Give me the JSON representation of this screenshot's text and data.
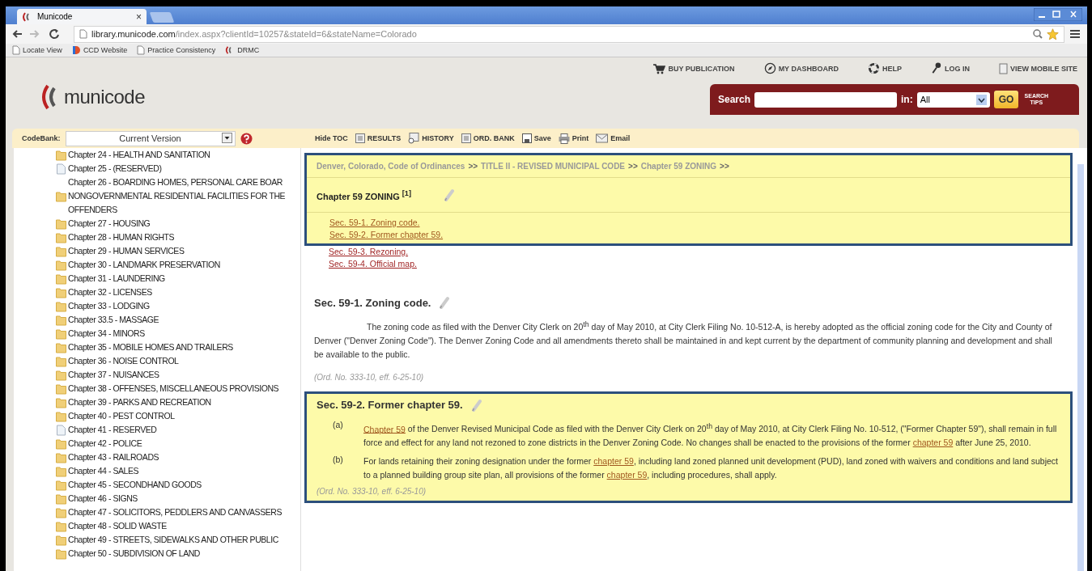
{
  "browser": {
    "tab": {
      "title": "Municode",
      "close": "×"
    },
    "address": {
      "host": "library.municode.com",
      "path": "/index.aspx?clientId=10257&stateId=6&stateName=Colorado"
    },
    "bookmarks": [
      {
        "label": "Locate View",
        "kind": "page"
      },
      {
        "label": "CCD Website",
        "kind": "site"
      },
      {
        "label": "Practice Consistency",
        "kind": "page"
      },
      {
        "label": "DRMC",
        "kind": "logo"
      }
    ]
  },
  "header": {
    "logo": "municode",
    "links": [
      {
        "label": "BUY PUBLICATION",
        "kind": "cart"
      },
      {
        "label": "MY DASHBOARD",
        "kind": "compass"
      },
      {
        "label": "HELP",
        "kind": "lifebuoy"
      },
      {
        "label": "LOG IN",
        "kind": "key"
      },
      {
        "label": "VIEW MOBILE SITE",
        "kind": "mobile"
      }
    ],
    "search": {
      "label": "Search",
      "in_label": "in:",
      "scope": "All",
      "go": "GO",
      "tips": "SEARCH TIPS"
    }
  },
  "toolbar": {
    "codebank_label": "CodeBank:",
    "version": "Current Version",
    "tools": [
      {
        "label": "Hide TOC",
        "kind": "none"
      },
      {
        "label": "RESULTS",
        "kind": "list"
      },
      {
        "label": "HISTORY",
        "kind": "history"
      },
      {
        "label": "ORD. BANK",
        "kind": "list"
      },
      {
        "label": "Save",
        "kind": "save"
      },
      {
        "label": "Print",
        "kind": "print"
      },
      {
        "label": "Email",
        "kind": "email"
      }
    ]
  },
  "toc": [
    {
      "label": "Chapter 24 - HEALTH AND SANITATION",
      "kind": "folder"
    },
    {
      "label": "Chapter 25 - (RESERVED)",
      "kind": "page"
    },
    {
      "label": "Chapter 26 - BOARDING HOMES, PERSONAL CARE BOAR NONGOVERNMENTAL RESIDENTIAL FACILITIES FOR THE OFFENDERS",
      "kind": "folder"
    },
    {
      "label": "Chapter 27 - HOUSING",
      "kind": "folder"
    },
    {
      "label": "Chapter 28 - HUMAN RIGHTS",
      "kind": "folder"
    },
    {
      "label": "Chapter 29 - HUMAN SERVICES",
      "kind": "folder"
    },
    {
      "label": "Chapter 30 - LANDMARK PRESERVATION",
      "kind": "folder"
    },
    {
      "label": "Chapter 31 - LAUNDERING",
      "kind": "folder"
    },
    {
      "label": "Chapter 32 - LICENSES",
      "kind": "folder"
    },
    {
      "label": "Chapter 33 - LODGING",
      "kind": "folder"
    },
    {
      "label": "Chapter 33.5 - MASSAGE",
      "kind": "folder"
    },
    {
      "label": "Chapter 34 - MINORS",
      "kind": "folder"
    },
    {
      "label": "Chapter 35 - MOBILE HOMES AND TRAILERS",
      "kind": "folder"
    },
    {
      "label": "Chapter 36 - NOISE CONTROL",
      "kind": "folder"
    },
    {
      "label": "Chapter 37 - NUISANCES",
      "kind": "folder"
    },
    {
      "label": "Chapter 38 - OFFENSES, MISCELLANEOUS PROVISIONS",
      "kind": "folder"
    },
    {
      "label": "Chapter 39 - PARKS AND RECREATION",
      "kind": "folder"
    },
    {
      "label": "Chapter 40 - PEST CONTROL",
      "kind": "folder"
    },
    {
      "label": "Chapter 41 - RESERVED",
      "kind": "page"
    },
    {
      "label": "Chapter 42 - POLICE",
      "kind": "folder"
    },
    {
      "label": "Chapter 43 - RAILROADS",
      "kind": "folder"
    },
    {
      "label": "Chapter 44 - SALES",
      "kind": "folder"
    },
    {
      "label": "Chapter 45 - SECONDHAND GOODS",
      "kind": "folder"
    },
    {
      "label": "Chapter 46 - SIGNS",
      "kind": "folder"
    },
    {
      "label": "Chapter 47 - SOLICITORS, PEDDLERS AND CANVASSERS",
      "kind": "folder"
    },
    {
      "label": "Chapter 48 - SOLID WASTE",
      "kind": "folder"
    },
    {
      "label": "Chapter 49 - STREETS, SIDEWALKS AND OTHER PUBLIC",
      "kind": "folder"
    },
    {
      "label": "Chapter 50 - SUBDIVISION OF LAND",
      "kind": "folder"
    }
  ],
  "content": {
    "breadcrumb": [
      "Denver, Colorado, Code of Ordinances",
      ">>",
      "TITLE II - REVISED MUNICIPAL CODE",
      ">>",
      "Chapter 59 ZONING",
      ">>"
    ],
    "chapter_title": "Chapter 59 ZONING $^{[1]}$",
    "section_links": [
      {
        "label": "Sec. 59-1. Zoning code.",
        "highlighted": true
      },
      {
        "label": "Sec. 59-2. Former chapter 59.",
        "highlighted": true
      },
      {
        "label": "Sec. 59-3. Rezoning.",
        "highlighted": false
      },
      {
        "label": "Sec. 59-4. Official map.",
        "highlighted": false
      }
    ],
    "sections": [
      {
        "heading": "Sec. 59-1. Zoning code.",
        "highlighted": false,
        "clauses": [
          {
            "segments": [
              {
                "text": "The zoning code as filed with the Denver City Clerk on 20$^{th}$ day of May 2010, at City Clerk Filing No. 10-512-A, is hereby adopted as the official zoning code for the City and County of Denver (\"Denver Zoning Code\"). The Denver Zoning Code and all amendments thereto shall be maintained in and kept current by the department of community planning and development and shall be available to the public.",
                "link": false
              }
            ]
          }
        ],
        "note": "(Ord. No. 333-10, eff. 6-25-10)"
      },
      {
        "heading": "Sec. 59-2. Former chapter 59.",
        "highlighted": true,
        "clauses": [
          {
            "label": "(a)",
            "segments": [
              {
                "text": "Chapter 59",
                "link": true
              },
              {
                "text": " of the Denver Revised Municipal Code as filed with the Denver City Clerk on 20$^{th}$ day of May 2010, at City Clerk Filing No. 10-512, (\"Former Chapter 59\"), shall remain in full force and effect for any land not rezoned to zone districts in the Denver Zoning Code. No changes shall be enacted to the provisions of the former ",
                "link": false
              },
              {
                "text": "chapter 59",
                "link": true
              },
              {
                "text": " after June 25, 2010.",
                "link": false
              }
            ]
          },
          {
            "label": "(b)",
            "segments": [
              {
                "text": "For lands retaining their zoning designation under the former ",
                "link": false
              },
              {
                "text": "chapter 59",
                "link": true
              },
              {
                "text": ", including land zoned planned unit development (PUD), land zoned with waivers and conditions and land subject to a planned building group site plan, all provisions of the former ",
                "link": false
              },
              {
                "text": "chapter 59",
                "link": true
              },
              {
                "text": ", including procedures, shall apply.",
                "link": false
              }
            ]
          }
        ],
        "note": "(Ord. No. 333-10, eff. 6-25-10)"
      }
    ]
  }
}
